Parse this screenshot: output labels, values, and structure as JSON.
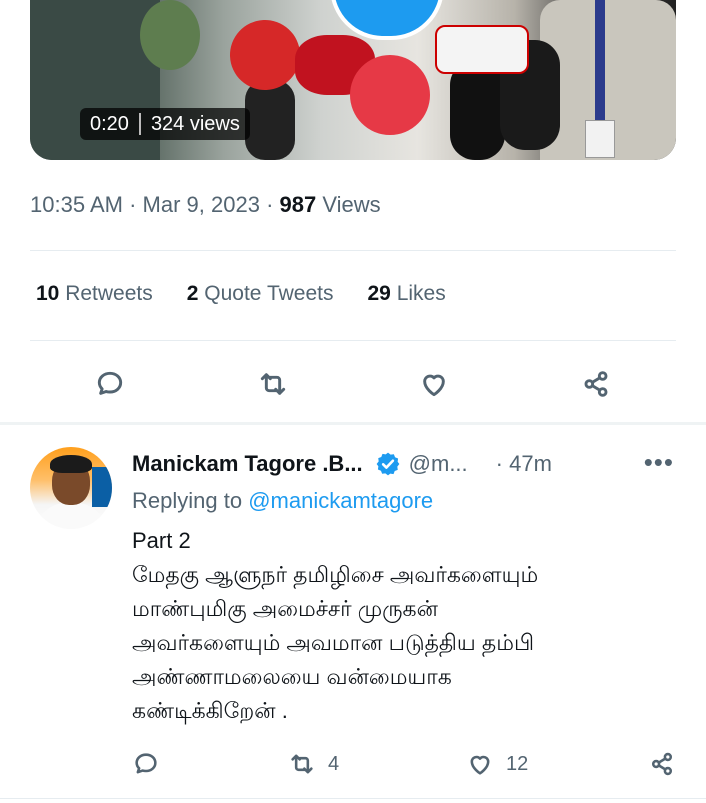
{
  "video": {
    "duration": "0:20",
    "views": "324 views"
  },
  "tweet_meta": {
    "time": "10:35 AM",
    "date": "Mar 9, 2023",
    "views_count": "987",
    "views_label": "Views"
  },
  "stats": {
    "retweets_count": "10",
    "retweets_label": "Retweets",
    "quotes_count": "2",
    "quotes_label": "Quote Tweets",
    "likes_count": "29",
    "likes_label": "Likes"
  },
  "actions": {
    "reply_icon": "comment-icon",
    "retweet_icon": "retweet-icon",
    "like_icon": "heart-icon",
    "share_icon": "share-icon"
  },
  "reply_tweet": {
    "author_name": "Manickam Tagore .B...",
    "handle": "@m...",
    "time": "· 47m",
    "more": "•••",
    "replying_prefix": "Replying to",
    "replying_mention": "@manickamtagore",
    "text": "Part 2\nமேதகு ஆளுநர் தமிழிசை அவர்களையும்\nமாண்புமிகு அமைச்சர் முருகன்\nஅவர்களையும் அவமான படுத்திய தம்பி\nஅண்ணாமலையை வன்மையாக\nகண்டிக்கிறேன் .",
    "retweet_count": "4",
    "like_count": "12"
  },
  "colors": {
    "accent": "#1d9bf0",
    "secondary_text": "#536471",
    "primary_text": "#0f1419"
  }
}
